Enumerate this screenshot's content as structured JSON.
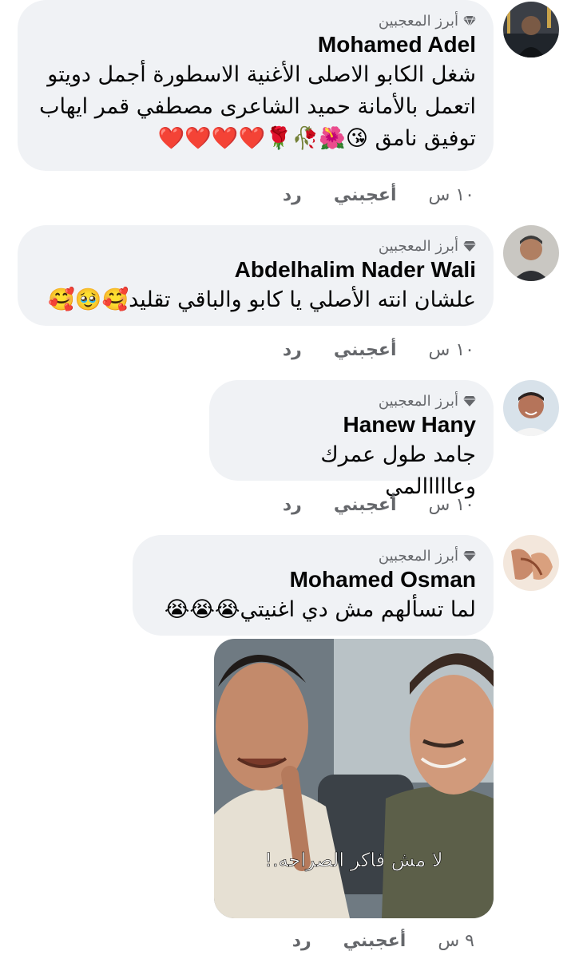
{
  "comments": [
    {
      "badge": "أبرز المعجبين",
      "name": "Mohamed Adel",
      "text": "شغل الكابو الاصلى الأغنية الاسطورة أجمل دويتو اتعمل بالأمانة حميد الشاعرى مصطفي قمر ايهاب توفيق نامق 😘🌺🥀🌹❤️❤️❤️❤️",
      "time": "١٠ س",
      "like": "أعجبني",
      "reply": "رد"
    },
    {
      "badge": "أبرز المعجبين",
      "name": "Abdelhalim Nader Wali",
      "text": "علشان انته الأصلي يا كابو والباقي تقليد🥰🥹🥰",
      "time": "١٠ س",
      "like": "أعجبني",
      "reply": "رد"
    },
    {
      "badge": "أبرز المعجبين",
      "name": "Hanew Hany",
      "text": "جامد طول عمرك وعااااالمي",
      "time": "١٠ س",
      "like": "أعجبني",
      "reply": "رد"
    },
    {
      "badge": "أبرز المعجبين",
      "name": "Mohamed Osman",
      "text": "لما تسألهم مش دي اغنيتي😭😭😭",
      "time": "٩ س",
      "like": "أعجبني",
      "reply": "رد",
      "image_caption": "لا مش فاكر الصراحه.!"
    }
  ],
  "colors": {
    "bubble": "#f0f2f5",
    "meta": "#65676b",
    "text": "#050505"
  },
  "icons": {
    "badge": "diamond-icon"
  }
}
